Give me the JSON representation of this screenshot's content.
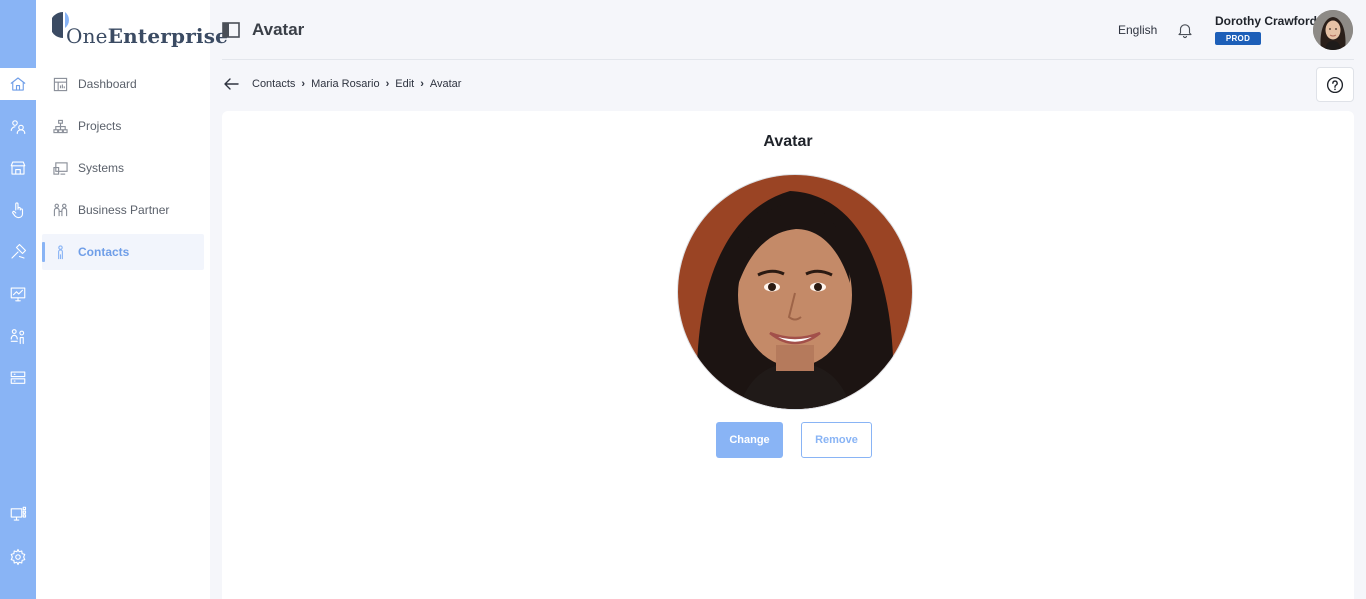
{
  "app": {
    "logo_text_light": "One",
    "logo_text_bold": "Enterprise",
    "brand_color": "#89b4f5"
  },
  "rail": {
    "items": [
      {
        "icon": "home-icon",
        "active": true
      },
      {
        "icon": "people-icon",
        "active": false
      },
      {
        "icon": "store-icon",
        "active": false
      },
      {
        "icon": "pointer-hand-icon",
        "active": false
      },
      {
        "icon": "tools-icon",
        "active": false
      },
      {
        "icon": "monitor-chart-icon",
        "active": false
      },
      {
        "icon": "users-group-icon",
        "active": false
      },
      {
        "icon": "server-icon",
        "active": false
      }
    ],
    "bottom_items": [
      {
        "icon": "monitor-grid-icon"
      },
      {
        "icon": "gear-icon"
      }
    ]
  },
  "sidebar": {
    "items": [
      {
        "label": "Dashboard",
        "icon": "dashboard-icon",
        "active": false
      },
      {
        "label": "Projects",
        "icon": "hierarchy-icon",
        "active": false
      },
      {
        "label": "Systems",
        "icon": "systems-icon",
        "active": false
      },
      {
        "label": "Business Partner",
        "icon": "partners-icon",
        "active": false
      },
      {
        "label": "Contacts",
        "icon": "contact-person-icon",
        "active": true
      }
    ]
  },
  "header": {
    "title": "Avatar",
    "language": "English",
    "user_name": "Dorothy Crawford",
    "environment": "PROD"
  },
  "breadcrumb": {
    "items": [
      "Contacts",
      "Maria Rosario",
      "Edit",
      "Avatar"
    ]
  },
  "card": {
    "title": "Avatar",
    "change_label": "Change",
    "remove_label": "Remove"
  }
}
